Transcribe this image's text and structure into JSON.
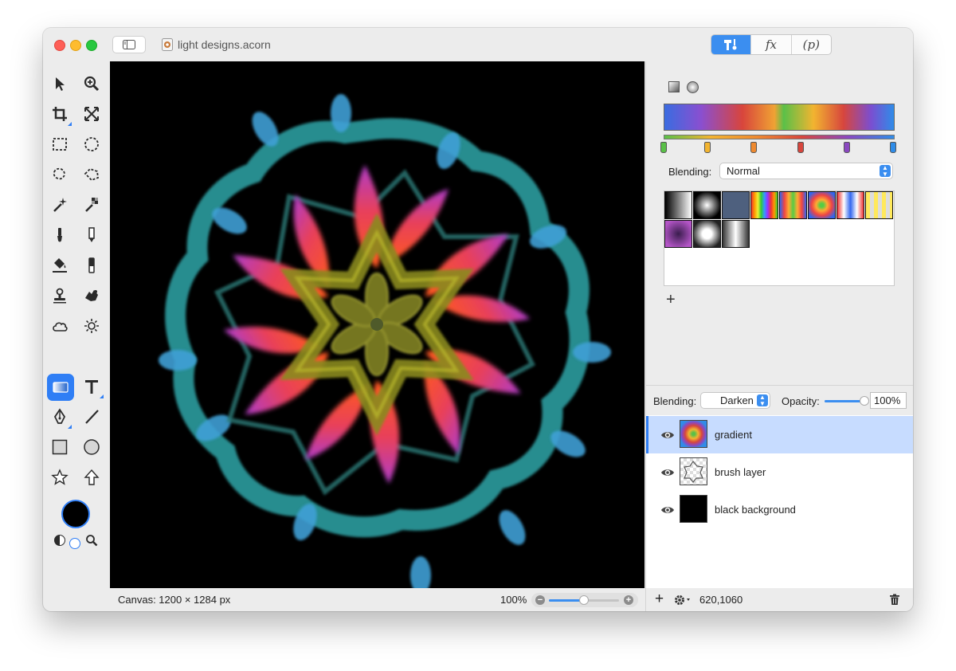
{
  "window": {
    "title": "light designs.acorn"
  },
  "inspector_tabs": [
    {
      "label": "",
      "icon": "tools-icon",
      "active": true
    },
    {
      "label": "fx",
      "icon": "fx",
      "active": false
    },
    {
      "label": "(p)",
      "icon": "properties",
      "active": false
    }
  ],
  "toolbox": {
    "tools": [
      "arrow-select-tool",
      "zoom-tool",
      "crop-tool",
      "transform-tool",
      "rect-select-tool",
      "ellipse-select-tool",
      "lasso-tool",
      "polygon-lasso-tool",
      "magic-wand-tool",
      "instant-alpha-tool",
      "brush-tool",
      "pencil-tool",
      "paint-bucket-tool",
      "eraser-tool",
      "clone-stamp-tool",
      "smudge-tool",
      "cloud-tool",
      "flare-tool",
      "gradient-tool",
      "text-tool",
      "bezier-pen-tool",
      "line-tool",
      "rectangle-shape-tool",
      "oval-shape-tool",
      "star-tool",
      "arrow-shape-tool"
    ],
    "selected_tool": "gradient-tool",
    "foreground_color": "#000000",
    "background_color": "#ffffff"
  },
  "gradient_panel": {
    "type_icons": [
      "linear-gradient-icon",
      "radial-gradient-icon"
    ],
    "stop_colors": [
      "#5ac048",
      "#f2b430",
      "#ee8a30",
      "#d7463d",
      "#8a48c0",
      "#2f8ce8"
    ],
    "blending_label": "Blending:",
    "blending_value": "Normal",
    "add_label": "+"
  },
  "layers_panel": {
    "blending_label": "Blending:",
    "blending_value": "Darken",
    "opacity_label": "Opacity:",
    "opacity_value": "100%",
    "opacity_fraction": 1.0,
    "layers": [
      {
        "name": "gradient",
        "visible": true,
        "selected": true
      },
      {
        "name": "brush layer",
        "visible": true,
        "selected": false
      },
      {
        "name": "black background",
        "visible": true,
        "selected": false
      }
    ]
  },
  "status": {
    "canvas_size": "Canvas: 1200 × 1284 px",
    "zoom": "100%",
    "zoom_fraction": 0.5,
    "coordinates": "620,1060",
    "add_label": "+"
  }
}
